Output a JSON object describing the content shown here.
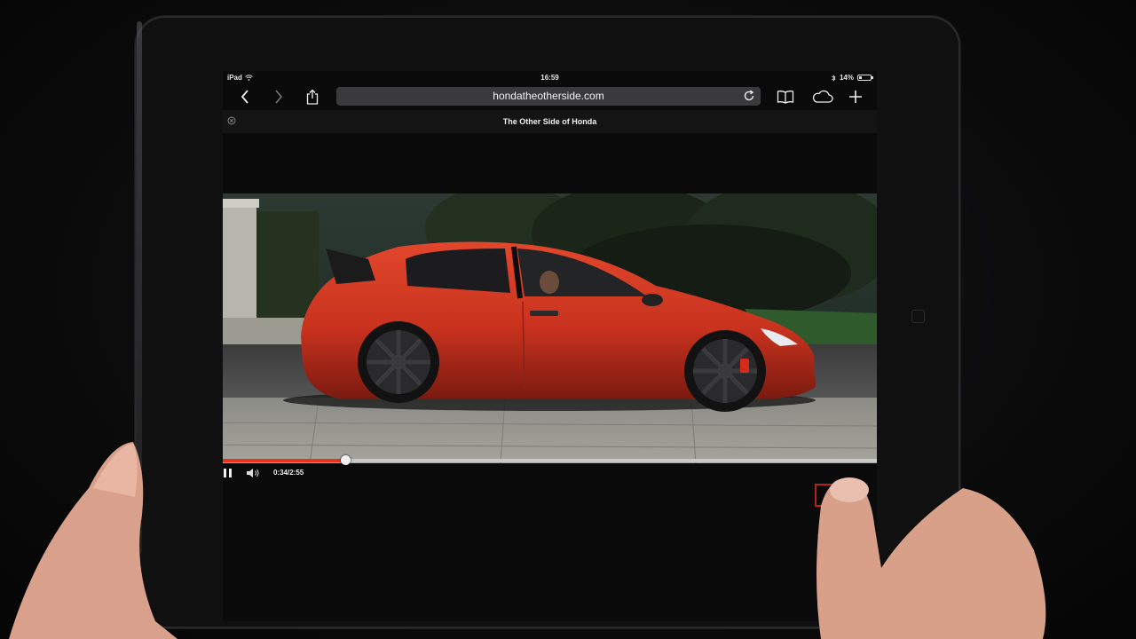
{
  "status_bar": {
    "device": "iPad",
    "time": "16:59",
    "battery": "14%"
  },
  "browser": {
    "url": "hondatheotherside.com",
    "tab_title": "The Other Side of Honda",
    "icons": [
      "back-icon",
      "forward-icon",
      "share-icon",
      "reload-icon",
      "bookmarks-icon",
      "icloud-tabs-icon",
      "new-tab-icon",
      "tab-close-icon"
    ]
  },
  "player": {
    "time": "0:34/2:55",
    "progress": 0.2,
    "accent_color": "#e8341c",
    "icons": [
      "pause-icon",
      "volume-icon"
    ]
  },
  "colors": {
    "car": "#c8321e",
    "toolbar_bg": "#0a0a0a",
    "url_field_bg": "#3a3a3c"
  }
}
